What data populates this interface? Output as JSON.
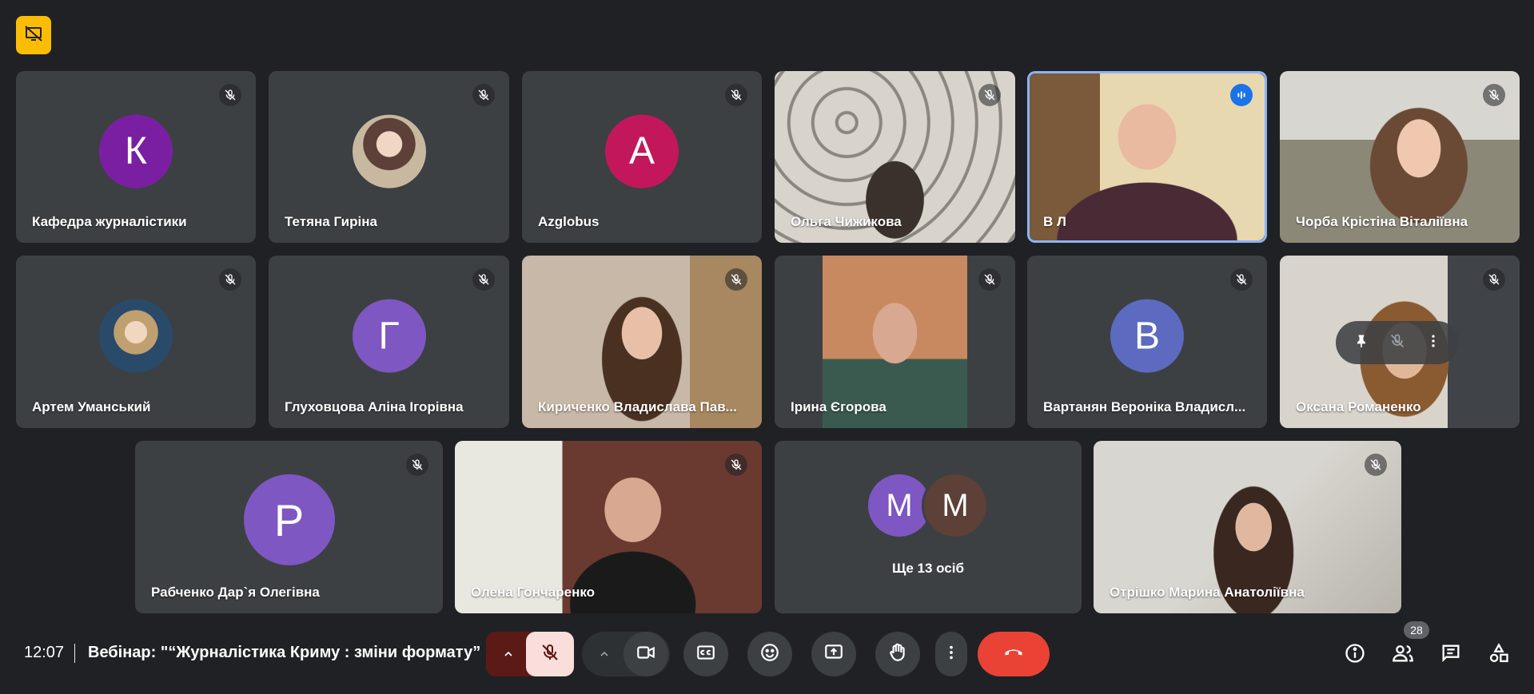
{
  "top_badge": {
    "icon": "presentation-off-icon",
    "color": "#fbbc04"
  },
  "participants": [
    {
      "name": "Кафедра журналістики",
      "avatar_letter": "К",
      "avatar_color": "#7b1fa2"
    },
    {
      "name": "Тетяна Гиріна",
      "avatar_letter": "",
      "avatar_color": "#8d6e63"
    },
    {
      "name": "Azglobus",
      "avatar_letter": "A",
      "avatar_color": "#c2185b"
    },
    {
      "name": "Ольга Чижикова",
      "avatar_letter": "",
      "avatar_color": ""
    },
    {
      "name": "В Л",
      "avatar_letter": "",
      "avatar_color": ""
    },
    {
      "name": "Чорба Крістіна Віталіївна",
      "avatar_letter": "",
      "avatar_color": ""
    },
    {
      "name": "Артем Уманський",
      "avatar_letter": "",
      "avatar_color": "#37474f"
    },
    {
      "name": "Глуховцова Аліна Ігорівна",
      "avatar_letter": "Г",
      "avatar_color": "#7e57c2"
    },
    {
      "name": "Кириченко Владислава Пав...",
      "avatar_letter": "",
      "avatar_color": ""
    },
    {
      "name": "Ірина Єгорова",
      "avatar_letter": "",
      "avatar_color": ""
    },
    {
      "name": "Вартанян Вероніка Владисл...",
      "avatar_letter": "В",
      "avatar_color": "#5c6bc0"
    },
    {
      "name": "Оксана Романенко",
      "avatar_letter": "",
      "avatar_color": ""
    },
    {
      "name": "Рабченко Дар`я Олегівна",
      "avatar_letter": "Р",
      "avatar_color": "#7e57c2"
    },
    {
      "name": "Олена Гончаренко",
      "avatar_letter": "",
      "avatar_color": ""
    },
    {
      "name": "Отрішко Марина Анатоліївна",
      "avatar_letter": "",
      "avatar_color": ""
    }
  ],
  "more_people": {
    "label": "Ще 13 осіб",
    "avatars": [
      {
        "letter": "M",
        "color": "#7e57c2"
      },
      {
        "letter": "M",
        "color": "#5d4037"
      }
    ]
  },
  "bottom_bar": {
    "time": "12:07",
    "meeting_title": "Вебінар: \"“Журналістика Криму : зміни формату”",
    "participant_count": "28"
  },
  "colors": {
    "background": "#202124",
    "tile": "#3c4043",
    "speaking_border": "#8ab4f8",
    "end_call": "#ea4335",
    "muted_red": "#5c1a17"
  }
}
